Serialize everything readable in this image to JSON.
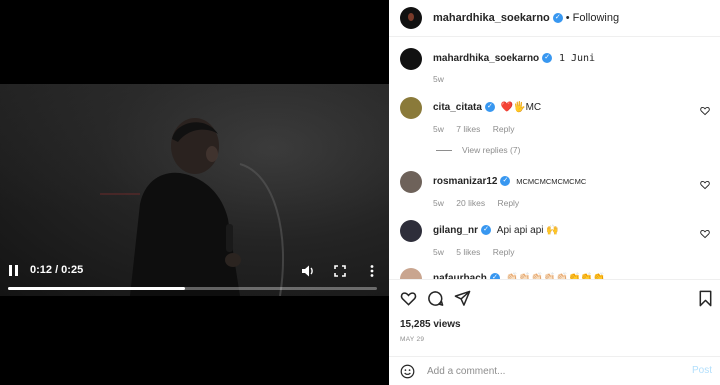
{
  "video": {
    "time": "0:12 / 0:25",
    "progress_fraction": 0.48
  },
  "header": {
    "username": "mahardhika_soekarno",
    "separator": "•",
    "follow_label": "Following"
  },
  "caption": {
    "username": "mahardhika_soekarno",
    "text": "1 Juni",
    "age": "5w"
  },
  "comments": [
    {
      "username": "cita_citata",
      "text": "❤️🖐MC",
      "age": "5w",
      "likes": "7 likes",
      "reply": "Reply"
    },
    {
      "username": "rosmanizar12",
      "text": "MCMCMCMCMCMC",
      "age": "5w",
      "likes": "20 likes",
      "reply": "Reply"
    },
    {
      "username": "gilang_nr",
      "text": "Api api api 🙌",
      "age": "5w",
      "likes": "5 likes",
      "reply": "Reply"
    },
    {
      "username": "nafaurbach",
      "text": "👏🏻👏🏻👏🏻👏🏻👏🏻👏👏👏",
      "age": "",
      "likes": "",
      "reply": ""
    }
  ],
  "view_replies": "View replies (7)",
  "stats": {
    "views": "15,285 views",
    "date": "MAY 29"
  },
  "add_comment": {
    "placeholder": "Add a comment...",
    "post_label": "Post"
  },
  "colors": {
    "verified": "#3897f0",
    "meta": "#8e8e8e",
    "post_disabled": "#b2dffc"
  }
}
